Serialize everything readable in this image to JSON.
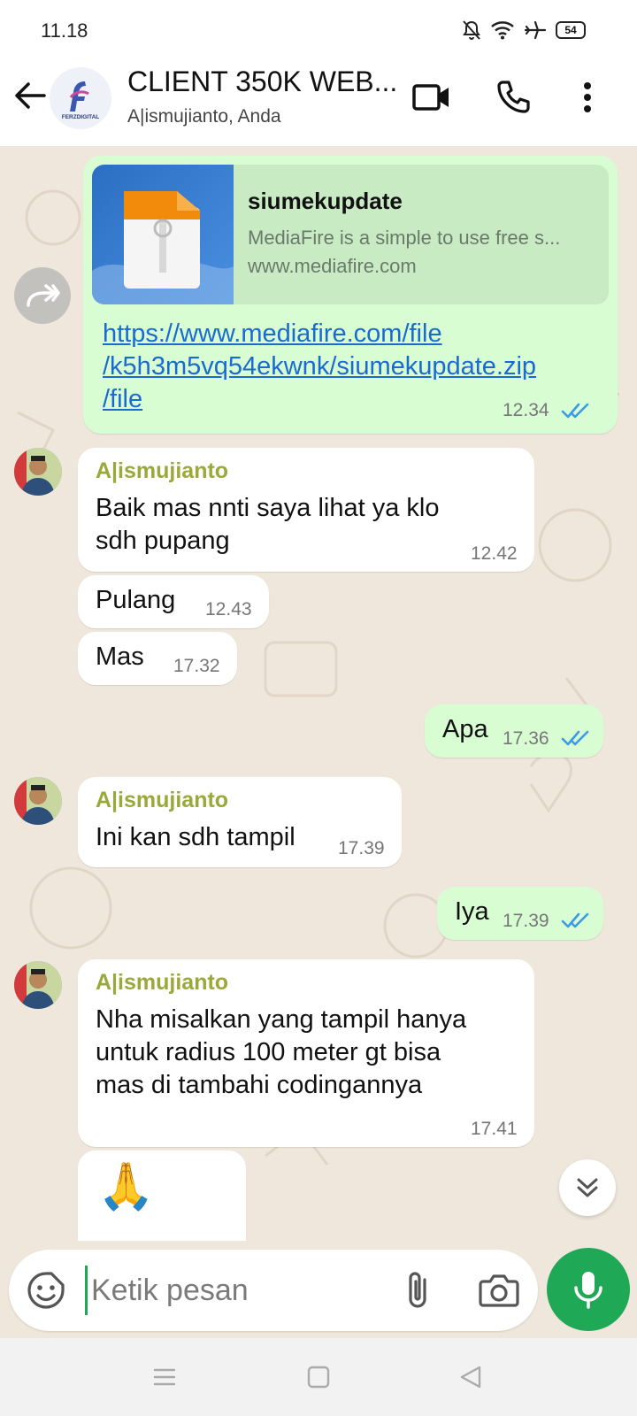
{
  "status": {
    "time": "11.18",
    "battery": "54",
    "icons": [
      "mute-bell-icon",
      "wifi-icon",
      "airplane-icon",
      "battery-icon"
    ]
  },
  "header": {
    "title": "CLIENT 350K WEB...",
    "subtitle": "A|ismujianto, Anda",
    "avatar_text": "FERZDIGITAL",
    "icons": [
      "back-arrow-icon",
      "video-call-icon",
      "phone-icon",
      "more-vert-icon"
    ]
  },
  "messages": {
    "link_message": {
      "card_title": "siumekupdate",
      "card_description": "MediaFire is a simple to use free s...",
      "card_domain": "www.mediafire.com",
      "url_line1": "https://www.mediafire.com/file",
      "url_line2": "/k5h3m5vq54ekwnk/siumekupdate.zip",
      "url_line3": "/file",
      "time": "12.34",
      "status": "read"
    },
    "m1": {
      "sender": "A|ismujianto",
      "line1": "Baik mas nnti saya lihat ya klo",
      "line2": "sdh pupang",
      "time": "12.42"
    },
    "m2": {
      "text": "Pulang",
      "time": "12.43"
    },
    "m3": {
      "text": "Mas",
      "time": "17.32"
    },
    "m4": {
      "text": "Apa",
      "time": "17.36",
      "status": "read"
    },
    "m5": {
      "sender": "A|ismujianto",
      "text": "Ini kan sdh tampil",
      "time": "17.39"
    },
    "m6": {
      "text": "Iya",
      "time": "17.39",
      "status": "read"
    },
    "m7": {
      "sender": "A|ismujianto",
      "line1": "Nha misalkan yang tampil hanya",
      "line2": "untuk radius 100 meter gt bisa",
      "line3": "mas di tambahi codingannya",
      "time": "17.41"
    },
    "m8": {
      "emoji": "🙏"
    }
  },
  "composer": {
    "placeholder": "Ketik pesan",
    "value": ""
  },
  "colors": {
    "accent": "#1fa855",
    "outgoing_bubble": "#d9fdd3",
    "incoming_bubble": "#ffffff",
    "chat_background": "#efe7dc",
    "sender_name": "#9aa93a",
    "read_ticks": "#3b9ae8",
    "link": "#1a6bd0"
  }
}
